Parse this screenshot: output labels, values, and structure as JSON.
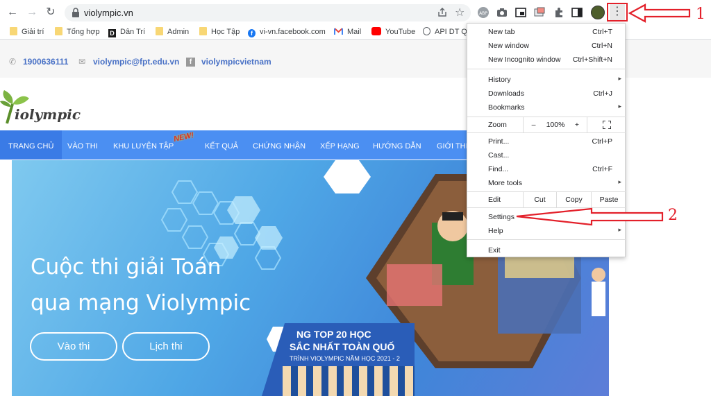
{
  "browser": {
    "url": "violympic.vn",
    "bookmarks": [
      {
        "label": "Giải trí",
        "icon": "folder-icon"
      },
      {
        "label": "Tổng hợp",
        "icon": "folder-icon"
      },
      {
        "label": "Dân Trí",
        "icon": "dantri-icon"
      },
      {
        "label": "Admin",
        "icon": "folder-icon"
      },
      {
        "label": "Học Tập",
        "icon": "folder-icon"
      },
      {
        "label": "vi-vn.facebook.com",
        "icon": "facebook-icon"
      },
      {
        "label": "Mail",
        "icon": "gmail-icon"
      },
      {
        "label": "YouTube",
        "icon": "youtube-icon"
      },
      {
        "label": "API DT Qu",
        "icon": "globe-icon"
      }
    ]
  },
  "site": {
    "phone": "1900636111",
    "email": "violympic@fpt.edu.vn",
    "facebook": "violympicvietnam",
    "logo_text": "iolympic",
    "nav": [
      "TRANG CHỦ",
      "VÀO THI",
      "KHU LUYỆN TẬP",
      "KẾT QUẢ",
      "CHỨNG NHẬN",
      "XẾP HẠNG",
      "HƯỚNG DẪN",
      "GIỚI THI"
    ],
    "new_badge": "NEW!",
    "headline_1": "Cuộc thi giải Toán",
    "headline_2": "qua mạng Violympic",
    "btn_vao_thi": "Vào thi",
    "btn_lich_thi": "Lịch thi",
    "banner_text_1": "NG TOP 20 HỌC",
    "banner_text_2": "SẮC NHẤT TOÀN QUỐ",
    "banner_text_3": "TRÌNH VIOLYMPIC NĂM HỌC 2021 - 2"
  },
  "menu": {
    "new_tab": {
      "label": "New tab",
      "shortcut": "Ctrl+T"
    },
    "new_window": {
      "label": "New window",
      "shortcut": "Ctrl+N"
    },
    "incognito": {
      "label": "New Incognito window",
      "shortcut": "Ctrl+Shift+N"
    },
    "history": "History",
    "downloads": {
      "label": "Downloads",
      "shortcut": "Ctrl+J"
    },
    "bookmarks": "Bookmarks",
    "zoom": {
      "label": "Zoom",
      "minus": "–",
      "value": "100%",
      "plus": "+"
    },
    "print": {
      "label": "Print...",
      "shortcut": "Ctrl+P"
    },
    "cast": "Cast...",
    "find": {
      "label": "Find...",
      "shortcut": "Ctrl+F"
    },
    "more_tools": "More tools",
    "edit": {
      "label": "Edit",
      "cut": "Cut",
      "copy": "Copy",
      "paste": "Paste"
    },
    "settings": "Settings",
    "help": "Help",
    "exit": "Exit"
  },
  "annotations": {
    "step1": "1",
    "step2": "2"
  },
  "colors": {
    "nav": "#4b8ff2",
    "accent_red": "#e3202a",
    "contact": "#4a72c6"
  }
}
